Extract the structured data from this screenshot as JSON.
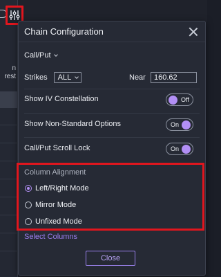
{
  "background": {
    "left_text_line1": "n",
    "left_text_line2": "rest"
  },
  "panel": {
    "title": "Chain Configuration",
    "callput_label": "Call/Put",
    "strikes_label": "Strikes",
    "strikes_value": "ALL",
    "near_label": "Near",
    "near_value": "160.62",
    "toggles": [
      {
        "label": "Show IV Constellation",
        "state": "Off"
      },
      {
        "label": "Show Non-Standard Options",
        "state": "On"
      },
      {
        "label": "Call/Put Scroll Lock",
        "state": "On"
      }
    ],
    "column_alignment": {
      "title": "Column Alignment",
      "options": [
        {
          "label": "Left/Right Mode",
          "selected": true
        },
        {
          "label": "Mirror Mode",
          "selected": false
        },
        {
          "label": "Unfixed Mode",
          "selected": false
        }
      ]
    },
    "select_columns_label": "Select Columns",
    "close_label": "Close"
  },
  "colors": {
    "accent": "#b28ff5",
    "highlight": "#e1161e",
    "panel_bg": "#262a35"
  }
}
